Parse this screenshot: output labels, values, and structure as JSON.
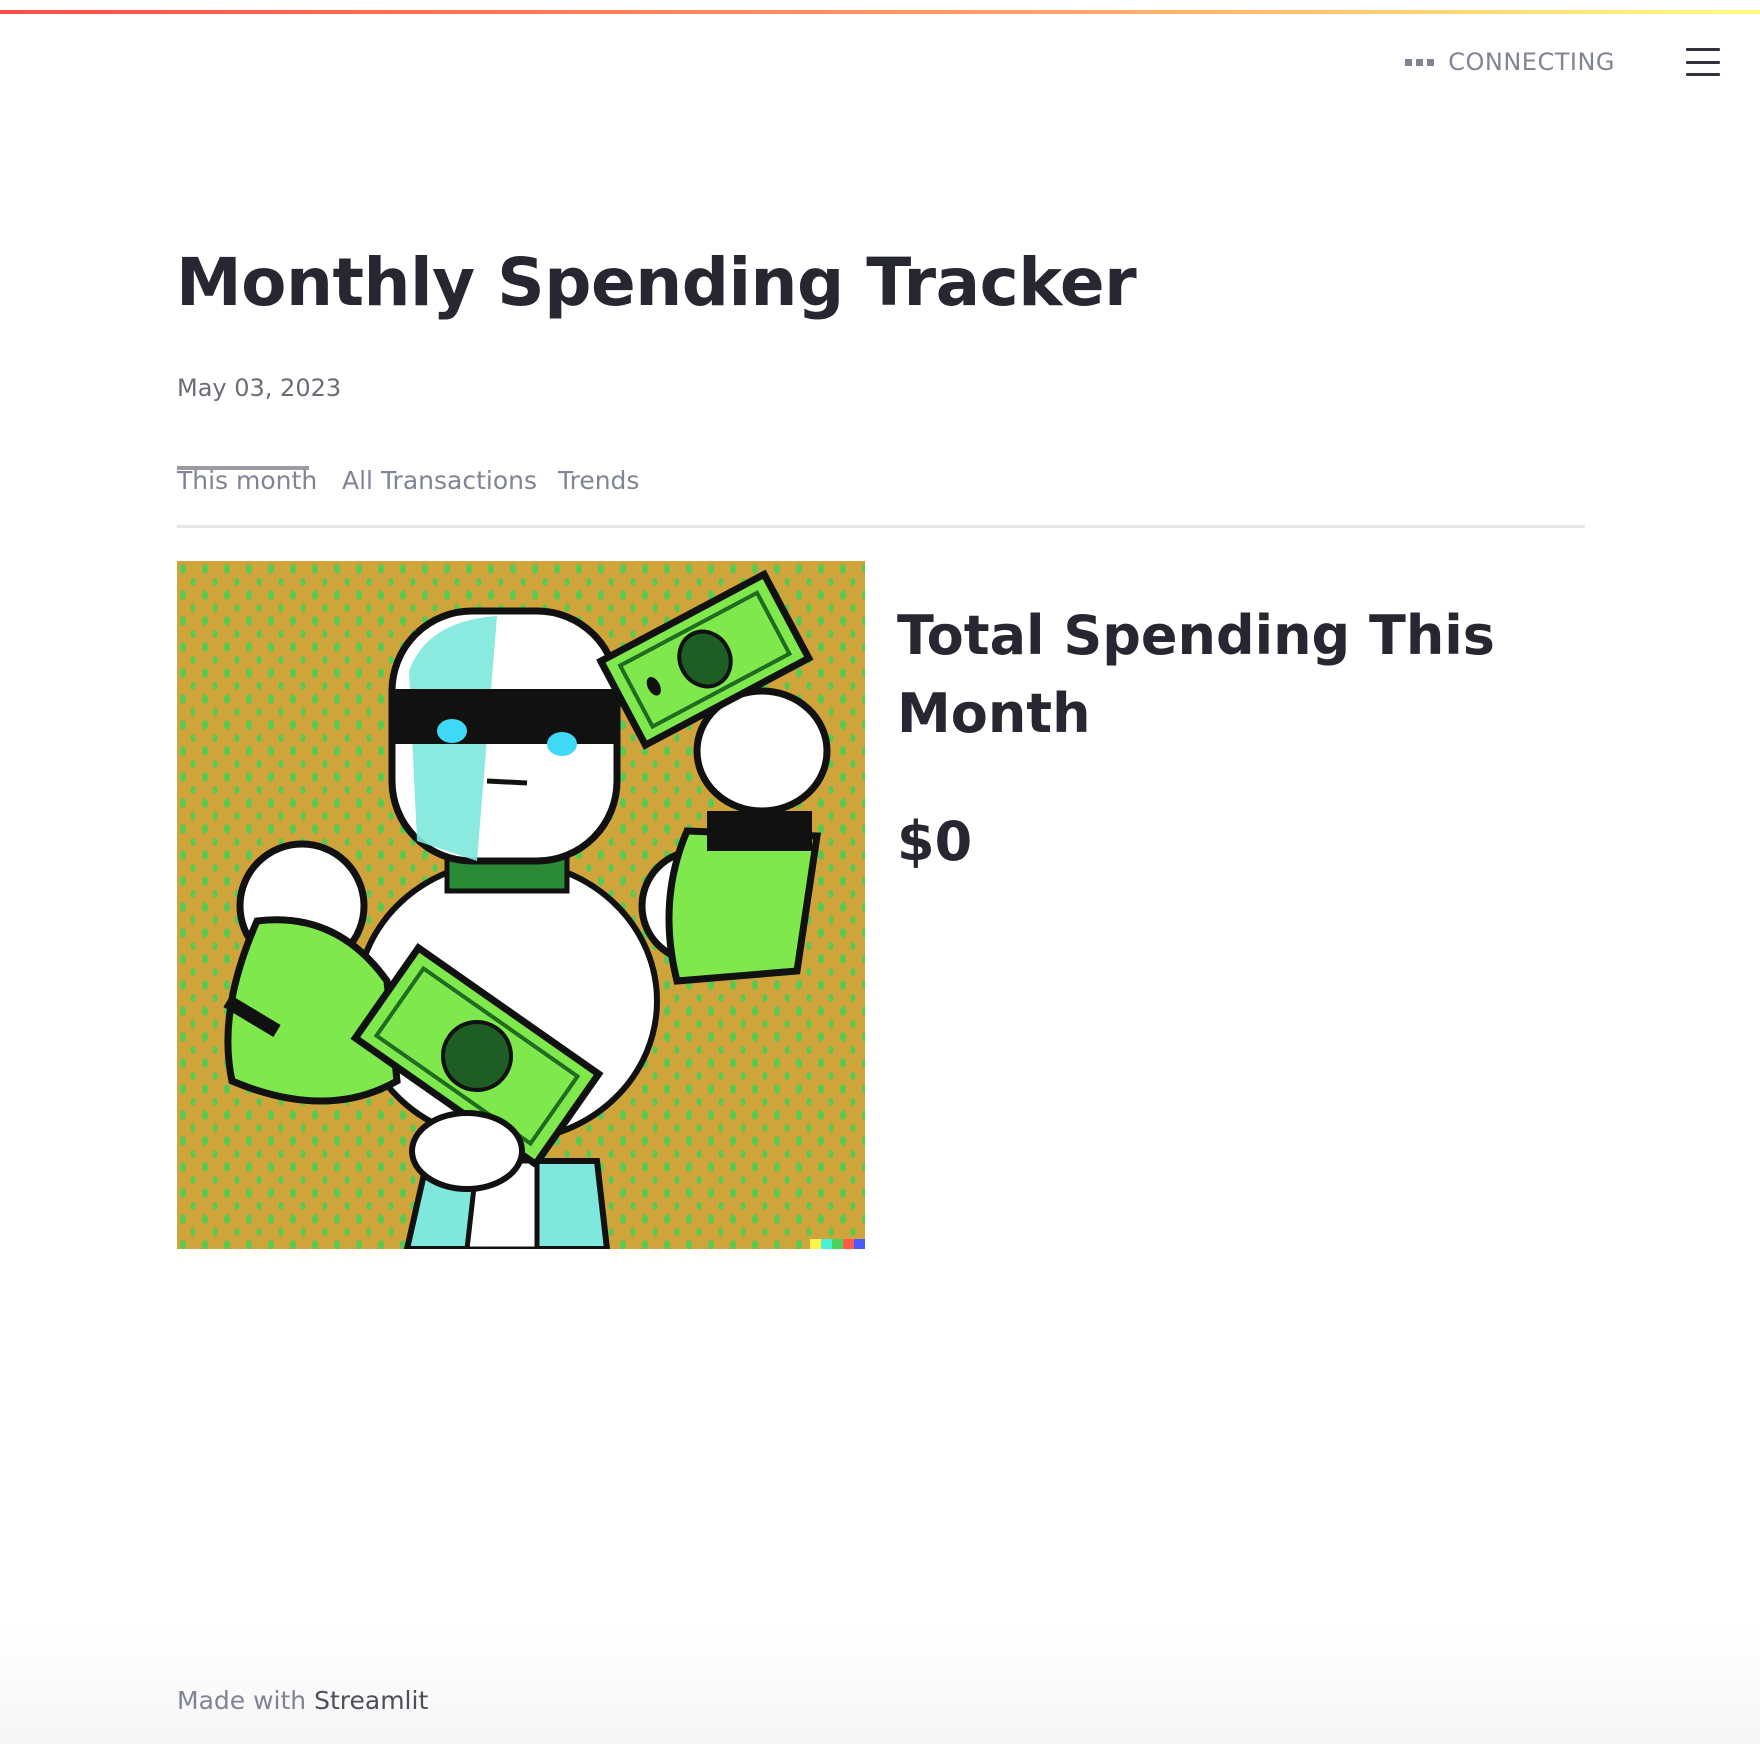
{
  "header": {
    "status_label": "CONNECTING",
    "menu_icon": "hamburger-menu-icon"
  },
  "main": {
    "title": "Monthly Spending Tracker",
    "date": "May 03, 2023",
    "tabs": [
      {
        "label": "This month",
        "active": true
      },
      {
        "label": "All Transactions",
        "active": false
      },
      {
        "label": "Trends",
        "active": false
      }
    ],
    "image": {
      "subject": "robot holding dollar bills illustration",
      "colors": {
        "background": "#cfa43a",
        "robot_green": "#7fe84c",
        "robot_cyan": "#7ee8dc"
      }
    },
    "total_heading": "Total Spending This Month",
    "total_amount": "$0"
  },
  "footer": {
    "prefix": "Made with",
    "link": "Streamlit"
  },
  "colors": {
    "accent_gradient": [
      "#ff4b4b",
      "#ffa36a",
      "#fffd80"
    ],
    "text": "#262730",
    "muted": "#808495"
  }
}
